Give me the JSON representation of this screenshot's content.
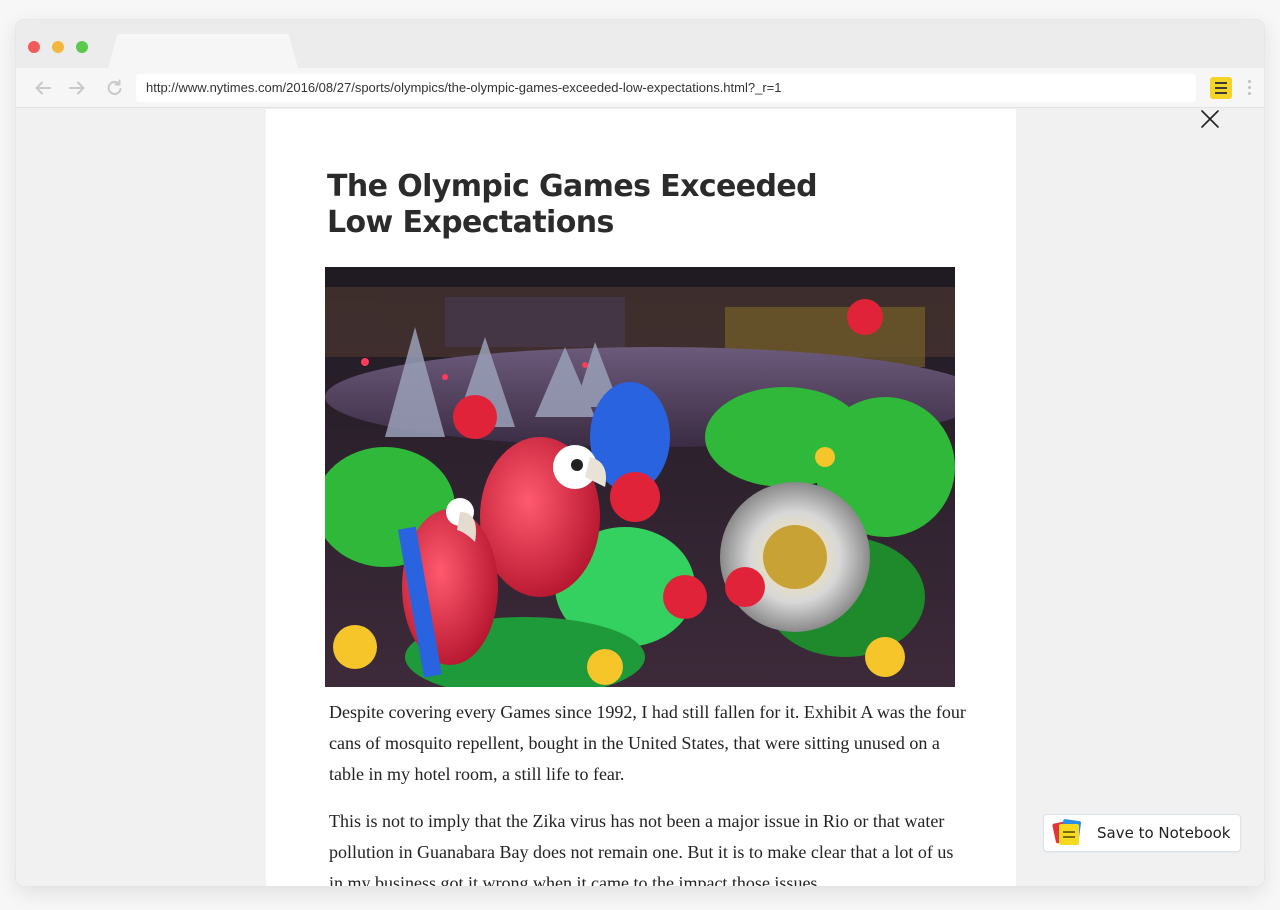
{
  "browser": {
    "url": "http://www.nytimes.com/2016/08/27/sports/olympics/the-olympic-games-exceeded-low-expectations.html?_r=1",
    "icons": [
      "back-arrow-icon",
      "forward-arrow-icon",
      "reload-icon",
      "notes-extension-icon",
      "more-vert-icon"
    ]
  },
  "article": {
    "headline": "The Olympic Games Exceeded Low Expectations",
    "paragraphs": [
      "Despite covering every Games since 1992, I had still fallen for it. Exhibit A was the four cans of mosquito repellent, bought in the United States, that were sitting unused on a table in my hotel room, a still life to fear.",
      "This is not to imply that the Zika virus has not been a major issue in Rio or that water pollution in Guanabara Bay does not remain one. But it is to make clear that a lot of us in my business got it wrong when it came to the impact those issues"
    ]
  },
  "reader": {
    "close_icon": "close-icon",
    "save_button_label": "Save to Notebook",
    "save_icon": "notebook-icon"
  },
  "colors": {
    "extension_yellow": "#f5d428",
    "notebook_red": "#e2343f",
    "notebook_blue": "#2a8fe8",
    "notebook_yellow": "#f7d91f"
  }
}
